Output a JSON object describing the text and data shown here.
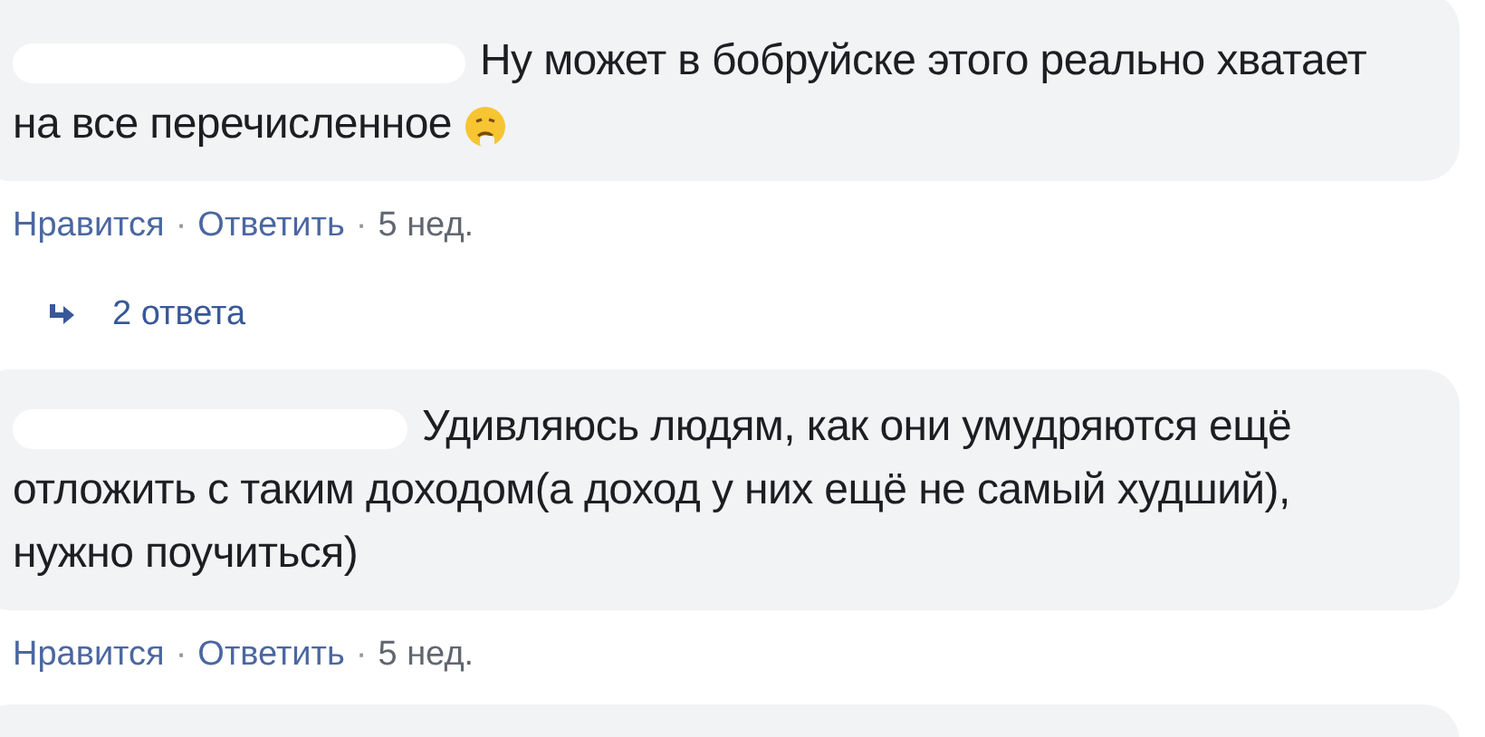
{
  "comments": [
    {
      "name_redacted": true,
      "text": "Ну может в бобруйске этого реально хватает на все перечисленное",
      "emoji": true,
      "actions": [
        {
          "label": "Нравится",
          "separator": "·"
        },
        {
          "label": "Ответить",
          "separator": "·"
        }
      ],
      "time": "5 нед.",
      "replies": "2 ответа"
    },
    {
      "name_redacted": true,
      "text": "Удивляюсь людям, как они умудряются ещё отложить с таким доходом(а доход у них ещё не самый худший), нужно поучиться)",
      "emoji": false,
      "actions": [
        {
          "label": "Нравится",
          "separator": "·"
        },
        {
          "label": "Ответить",
          "separator": "·"
        }
      ],
      "time": "5 нед."
    }
  ]
}
